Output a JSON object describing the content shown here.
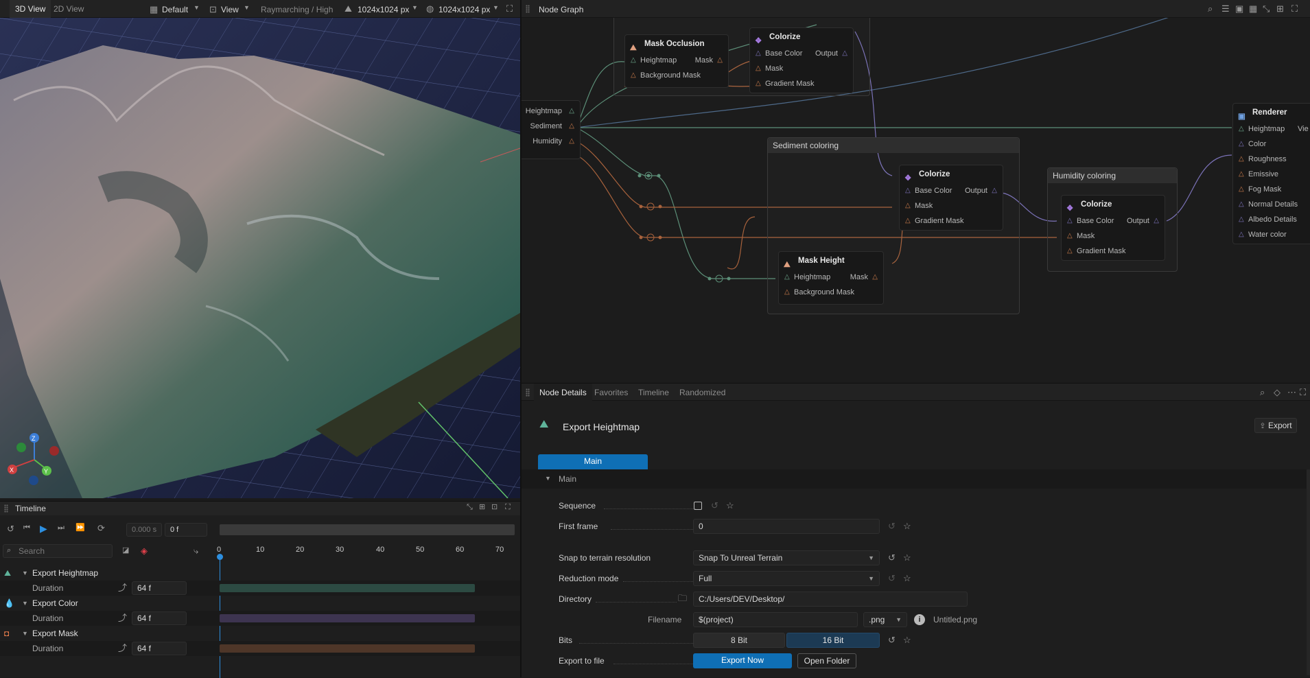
{
  "viewport": {
    "tabs": [
      "3D View",
      "2D View"
    ],
    "preset": "Default",
    "view_menu": "View",
    "render_mode": "Raymarching / High",
    "resolution_a": "1024x1024 px",
    "resolution_b": "1024x1024 px",
    "gizmo": {
      "x": "X",
      "y": "Y",
      "z": "Z"
    }
  },
  "node_graph": {
    "title": "Node Graph",
    "input_node": {
      "ports": [
        "Heightmap",
        "Sediment",
        "Humidity"
      ]
    },
    "mask_occlusion": {
      "title": "Mask Occlusion",
      "inputs": [
        "Heightmap",
        "Background Mask"
      ],
      "output": "Mask"
    },
    "colorize_top": {
      "title": "Colorize",
      "inputs": [
        "Base Color",
        "Mask",
        "Gradient Mask"
      ],
      "output": "Output"
    },
    "sediment_group": {
      "title": "Sediment coloring"
    },
    "colorize_sediment": {
      "title": "Colorize",
      "inputs": [
        "Base Color",
        "Mask",
        "Gradient Mask"
      ],
      "output": "Output"
    },
    "mask_height": {
      "title": "Mask Height",
      "inputs": [
        "Heightmap",
        "Background Mask"
      ],
      "output": "Mask"
    },
    "humidity_group": {
      "title": "Humidity coloring"
    },
    "colorize_humidity": {
      "title": "Colorize",
      "inputs": [
        "Base Color",
        "Mask",
        "Gradient Mask"
      ],
      "output": "Output"
    },
    "renderer": {
      "title": "Renderer",
      "inputs": [
        "Heightmap",
        "Color",
        "Roughness",
        "Emissive",
        "Fog Mask",
        "Normal Details",
        "Albedo Details",
        "Water color"
      ],
      "extra": "Vie"
    }
  },
  "details": {
    "tabs": [
      "Node Details",
      "Favorites",
      "Timeline",
      "Randomized"
    ],
    "node_title": "Export Heightmap",
    "export_button": "Export",
    "main_tab": "Main",
    "section": "Main",
    "rows": {
      "sequence": "Sequence",
      "first_frame_label": "First frame",
      "first_frame_value": "0",
      "snap_label": "Snap to terrain resolution",
      "snap_value": "Snap To Unreal Terrain",
      "reduction_label": "Reduction mode",
      "reduction_value": "Full",
      "directory_label": "Directory",
      "directory_value": "C:/Users/DEV/Desktop/",
      "filename_label": "Filename",
      "filename_value": "$(project)",
      "ext_value": ".png",
      "filename_preview": "Untitled.png",
      "bits_label": "Bits",
      "bits_8": "8 Bit",
      "bits_16": "16 Bit",
      "export_label": "Export to file",
      "export_now": "Export Now",
      "open_folder": "Open Folder"
    }
  },
  "timeline": {
    "title": "Timeline",
    "time_value": "0.000 s",
    "frame_value": "0 f",
    "search_placeholder": "Search",
    "ticks": [
      "0",
      "10",
      "20",
      "30",
      "40",
      "50",
      "60",
      "70"
    ],
    "tracks": [
      {
        "name": "Export Heightmap",
        "sub": "Duration",
        "value": "64 f",
        "color": "#2c4a42"
      },
      {
        "name": "Export Color",
        "sub": "Duration",
        "value": "64 f",
        "color": "#3d3450"
      },
      {
        "name": "Export Mask",
        "sub": "Duration",
        "value": "64 f",
        "color": "#4e3628"
      }
    ]
  },
  "colors": {
    "accent": "#0f6fb5",
    "port_orange": "#c87a4a",
    "port_green": "#6da58a",
    "port_purple": "#7b72b8"
  }
}
